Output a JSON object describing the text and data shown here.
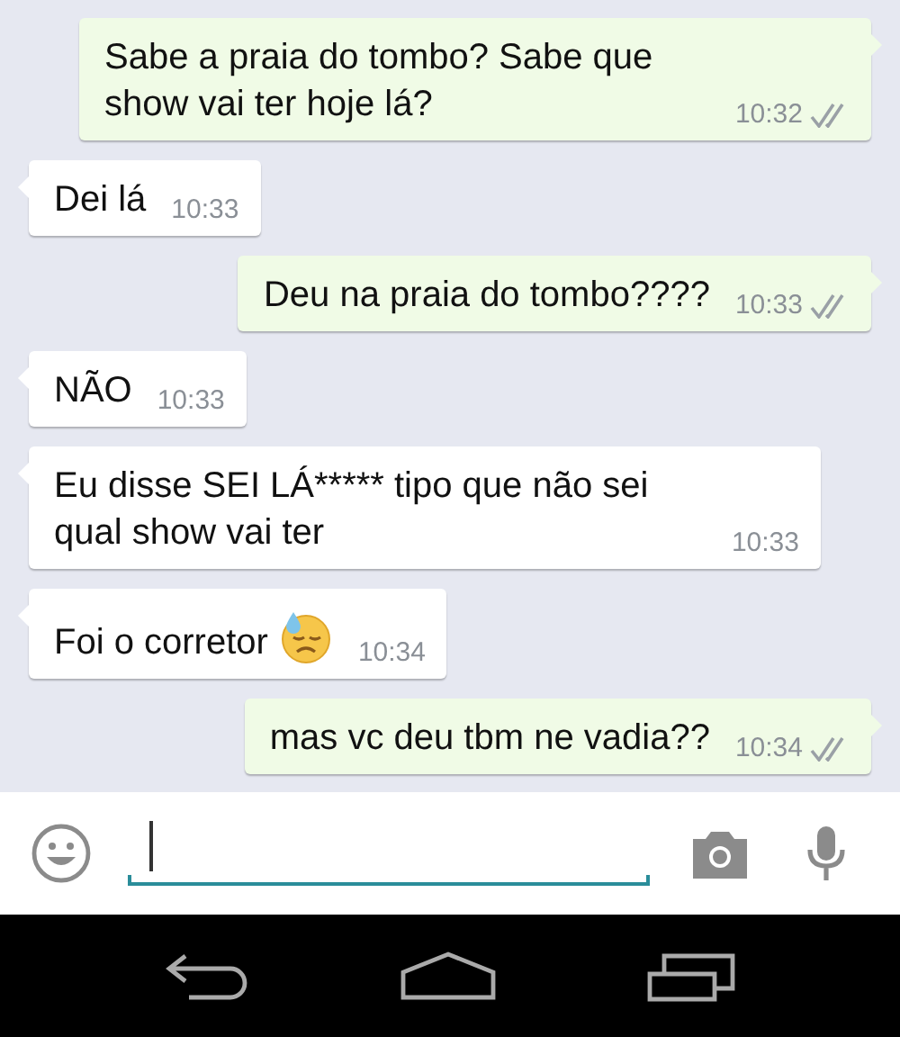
{
  "messages": [
    {
      "kind": "out",
      "text": "Sabe a praia do tombo? Sabe que show vai ter hoje lá?",
      "time": "10:32",
      "delivered": true,
      "emoji": false
    },
    {
      "kind": "in",
      "text": "Dei lá",
      "time": "10:33",
      "emoji": false
    },
    {
      "kind": "out",
      "text": "Deu na praia do tombo????",
      "time": "10:33",
      "delivered": true,
      "emoji": false
    },
    {
      "kind": "in",
      "text": "NÃO",
      "time": "10:33",
      "emoji": false
    },
    {
      "kind": "in",
      "text": "Eu disse SEI LÁ***** tipo que não sei qual show vai ter",
      "time": "10:33",
      "emoji": false
    },
    {
      "kind": "in",
      "text": "Foi o corretor",
      "time": "10:34",
      "emoji": true
    },
    {
      "kind": "out",
      "text": "mas vc deu tbm ne vadia??",
      "time": "10:34",
      "delivered": true,
      "emoji": false
    }
  ]
}
